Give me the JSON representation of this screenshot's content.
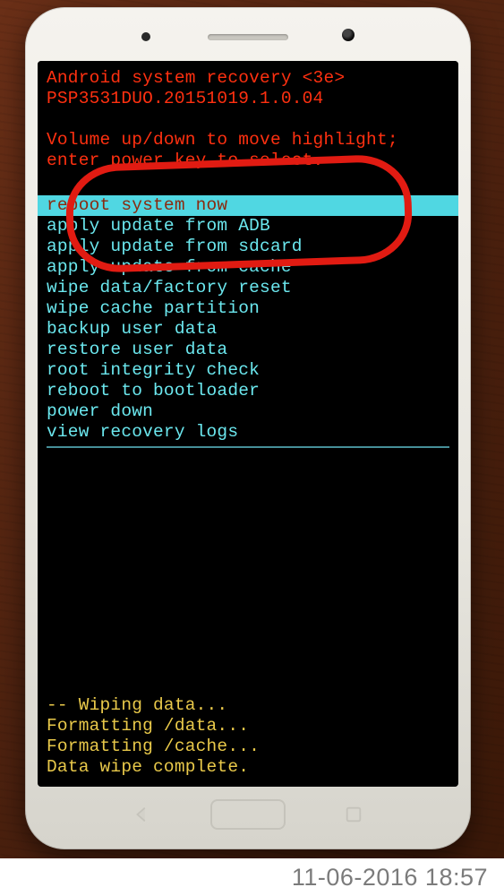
{
  "header": {
    "title": "Android system recovery <3e>",
    "build": "PSP3531DUO.20151019.1.0.04"
  },
  "instruction": {
    "l1": "Volume up/down to move highlight;",
    "l2": "enter power key to select."
  },
  "menu": {
    "selected": "reboot system now",
    "items": [
      "apply update from ADB",
      "apply update from sdcard",
      "apply update from cache",
      "wipe data/factory reset",
      "wipe cache partition",
      "backup user data",
      "restore user data",
      "root integrity check",
      "reboot to bootloader",
      "power down",
      "view recovery logs"
    ]
  },
  "log": [
    "-- Wiping data...",
    "Formatting /data...",
    "Formatting /cache...",
    "Data wipe complete."
  ],
  "timestamp": "11-06-2016  18:57"
}
